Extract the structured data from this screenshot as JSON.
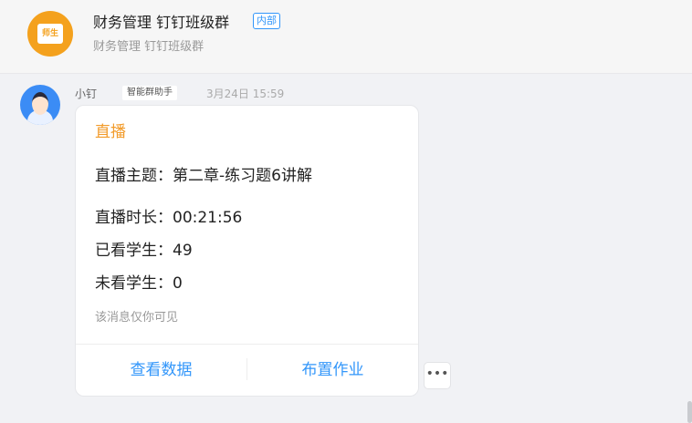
{
  "header": {
    "avatar_text": "师生",
    "title": "财务管理 钉钉班级群",
    "badge": "内部",
    "subtitle": "财务管理 钉钉班级群"
  },
  "message": {
    "sender": "小钉",
    "role": "智能群助手",
    "time": "3月24日 15:59",
    "card": {
      "title": "直播",
      "topic": "直播主题：第二章-练习题6讲解",
      "duration": "直播时长：00:21:56",
      "watched": "已看学生：49",
      "unwatched": "未看学生：0",
      "note": "该消息仅你可见",
      "actions": {
        "view_data": "查看数据",
        "assign_homework": "布置作业"
      }
    },
    "more_label": "•••"
  },
  "colors": {
    "accent": "#3296fa",
    "title_orange": "#f29b2a",
    "avatar_orange": "#f4a11d"
  }
}
